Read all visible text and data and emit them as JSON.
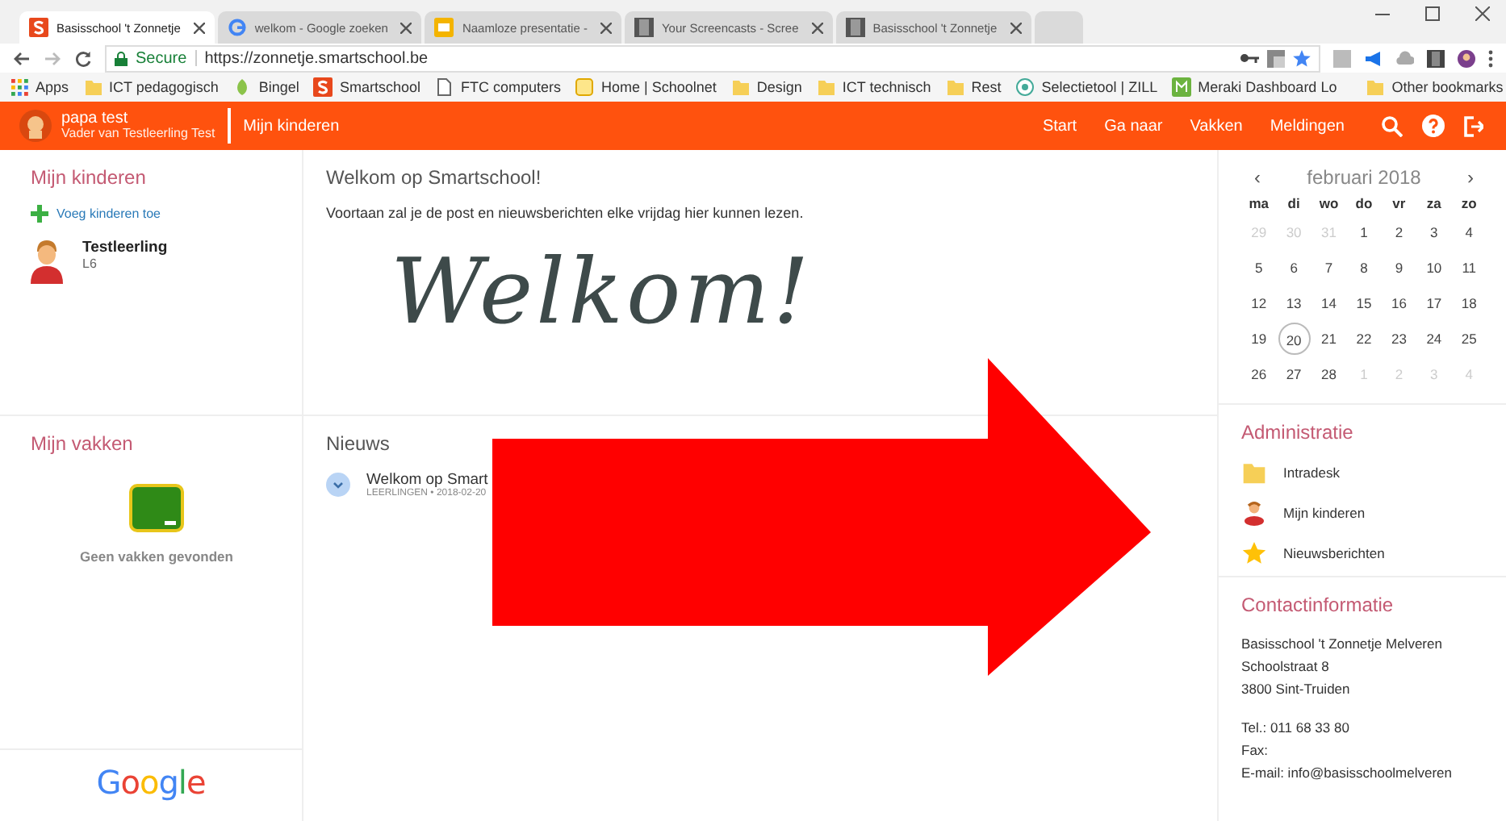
{
  "browser": {
    "tabs": [
      {
        "title": "Basisschool 't Zonnetje",
        "kind": "smartschool",
        "selected": true
      },
      {
        "title": "welkom - Google zoeken",
        "kind": "google",
        "selected": false
      },
      {
        "title": "Naamloze presentatie -",
        "kind": "slides",
        "selected": false
      },
      {
        "title": "Your Screencasts - Scree",
        "kind": "film",
        "selected": false
      },
      {
        "title": "Basisschool 't Zonnetje",
        "kind": "film",
        "selected": false
      }
    ],
    "secure_label": "Secure",
    "url": "https://zonnetje.smartschool.be",
    "bookmarks": [
      {
        "label": "Apps",
        "kind": "apps"
      },
      {
        "label": "ICT pedagogisch",
        "kind": "folder"
      },
      {
        "label": "Bingel",
        "kind": "bingel"
      },
      {
        "label": "Smartschool",
        "kind": "smartschool"
      },
      {
        "label": "FTC computers",
        "kind": "page"
      },
      {
        "label": "Home | Schoolnet",
        "kind": "schoolnet"
      },
      {
        "label": "Design",
        "kind": "folder"
      },
      {
        "label": "ICT technisch",
        "kind": "folder"
      },
      {
        "label": "Rest",
        "kind": "folder"
      },
      {
        "label": "Selectietool | ZILL",
        "kind": "zill"
      },
      {
        "label": "Meraki Dashboard Lo",
        "kind": "meraki"
      }
    ],
    "other_bookmarks": "Other bookmarks"
  },
  "header": {
    "user_name": "papa test",
    "user_role": "Vader van Testleerling Test",
    "section": "Mijn kinderen",
    "nav": [
      "Start",
      "Ga naar",
      "Vakken",
      "Meldingen"
    ]
  },
  "children_panel": {
    "title": "Mijn kinderen",
    "add_link": "Voeg kinderen toe",
    "children": [
      {
        "name": "Testleerling",
        "class": "L6"
      }
    ]
  },
  "courses_panel": {
    "title": "Mijn vakken",
    "empty_text": "Geen vakken gevonden"
  },
  "google_logo": "Google",
  "welcome": {
    "title": "Welkom op Smartschool!",
    "text": "Voortaan zal je de post en nieuwsberichten elke vrijdag hier kunnen lezen.",
    "banner": "Welkom!"
  },
  "news": {
    "title": "Nieuws",
    "items": [
      {
        "title": "Welkom op Smart",
        "meta": "LEERLINGEN • 2018-02-20"
      }
    ]
  },
  "calendar": {
    "month": "februari 2018",
    "prev": "‹",
    "next": "›",
    "weekdays": [
      "ma",
      "di",
      "wo",
      "do",
      "vr",
      "za",
      "zo"
    ],
    "days": [
      {
        "label": "29",
        "muted": true,
        "selected": false
      },
      {
        "label": "30",
        "muted": true,
        "selected": false
      },
      {
        "label": "31",
        "muted": true,
        "selected": false
      },
      {
        "label": "1",
        "muted": false,
        "selected": false
      },
      {
        "label": "2",
        "muted": false,
        "selected": false
      },
      {
        "label": "3",
        "muted": false,
        "selected": false
      },
      {
        "label": "4",
        "muted": false,
        "selected": false
      },
      {
        "label": "5",
        "muted": false,
        "selected": false
      },
      {
        "label": "6",
        "muted": false,
        "selected": false
      },
      {
        "label": "7",
        "muted": false,
        "selected": false
      },
      {
        "label": "8",
        "muted": false,
        "selected": false
      },
      {
        "label": "9",
        "muted": false,
        "selected": false
      },
      {
        "label": "10",
        "muted": false,
        "selected": false
      },
      {
        "label": "11",
        "muted": false,
        "selected": false
      },
      {
        "label": "12",
        "muted": false,
        "selected": false
      },
      {
        "label": "13",
        "muted": false,
        "selected": false
      },
      {
        "label": "14",
        "muted": false,
        "selected": false
      },
      {
        "label": "15",
        "muted": false,
        "selected": false
      },
      {
        "label": "16",
        "muted": false,
        "selected": false
      },
      {
        "label": "17",
        "muted": false,
        "selected": false
      },
      {
        "label": "18",
        "muted": false,
        "selected": false
      },
      {
        "label": "19",
        "muted": false,
        "selected": false
      },
      {
        "label": "20",
        "muted": false,
        "selected": true
      },
      {
        "label": "21",
        "muted": false,
        "selected": false
      },
      {
        "label": "22",
        "muted": false,
        "selected": false
      },
      {
        "label": "23",
        "muted": false,
        "selected": false
      },
      {
        "label": "24",
        "muted": false,
        "selected": false
      },
      {
        "label": "25",
        "muted": false,
        "selected": false
      },
      {
        "label": "26",
        "muted": false,
        "selected": false
      },
      {
        "label": "27",
        "muted": false,
        "selected": false
      },
      {
        "label": "28",
        "muted": false,
        "selected": false
      },
      {
        "label": "1",
        "muted": true,
        "selected": false
      },
      {
        "label": "2",
        "muted": true,
        "selected": false
      },
      {
        "label": "3",
        "muted": true,
        "selected": false
      },
      {
        "label": "4",
        "muted": true,
        "selected": false
      }
    ]
  },
  "administratie": {
    "title": "Administratie",
    "items": [
      {
        "label": "Intradesk",
        "kind": "folder"
      },
      {
        "label": "Mijn kinderen",
        "kind": "child"
      },
      {
        "label": "Nieuwsberichten",
        "kind": "star"
      }
    ]
  },
  "contact": {
    "title": "Contactinformatie",
    "address": [
      "Basisschool 't Zonnetje Melveren",
      "Schoolstraat 8",
      "3800 Sint-Truiden"
    ],
    "phone": [
      "Tel.: 011 68 33 80",
      "Fax:",
      "E-mail: info@basisschoolmelveren"
    ]
  }
}
